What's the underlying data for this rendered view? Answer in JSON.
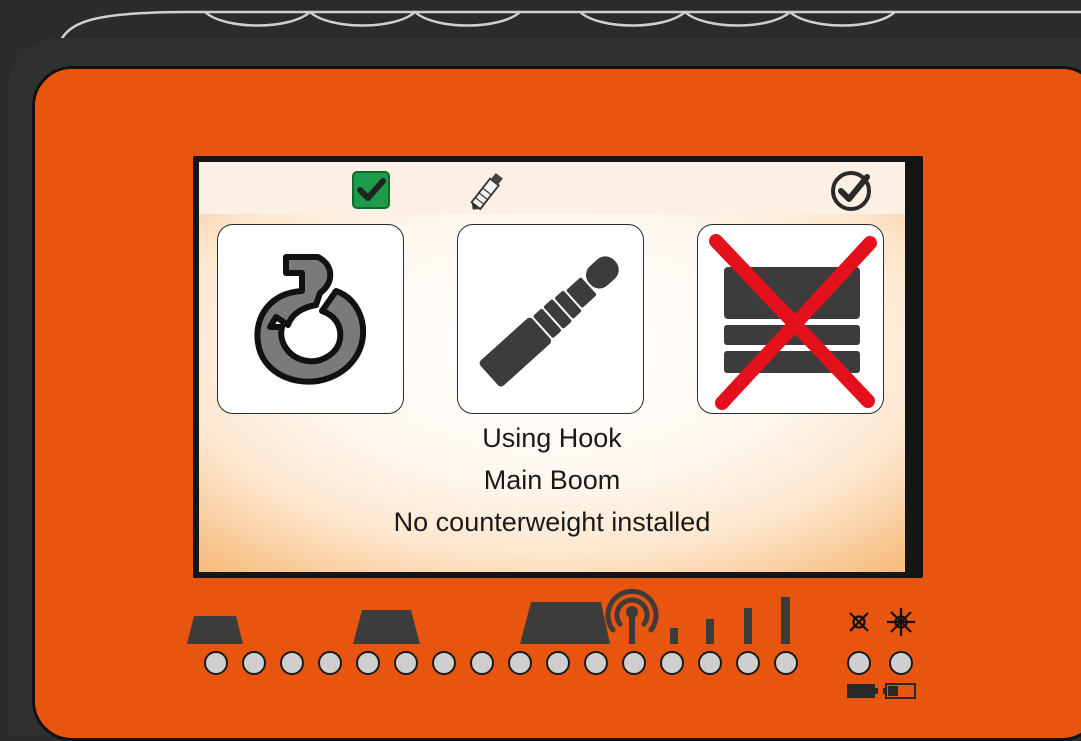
{
  "screen": {
    "status_icons": [
      "check-box-icon",
      "pencil-icon",
      "check-circle-icon"
    ],
    "tiles": [
      {
        "name": "hook-mode-tile",
        "icon": "crane-hook-icon"
      },
      {
        "name": "boom-mode-tile",
        "icon": "telescopic-boom-icon"
      },
      {
        "name": "counterweight-tile",
        "icon": "counterweight-crossed-icon"
      }
    ],
    "status_lines": [
      "Using Hook",
      "Main Boom",
      "No counterweight installed"
    ]
  },
  "controls": {
    "led_count": 16,
    "aux_led_count": 2,
    "indicator_icons": [
      "antenna-icon",
      "signal-strength-icon",
      "light-off-icon",
      "light-on-icon",
      "battery-full-icon",
      "battery-low-icon"
    ]
  },
  "colors": {
    "panel": "#e8550f",
    "ok_green": "#1e9a4b",
    "x_red": "#e4101c",
    "led": "#cfcfcf",
    "dark": "#3c3c3c"
  }
}
